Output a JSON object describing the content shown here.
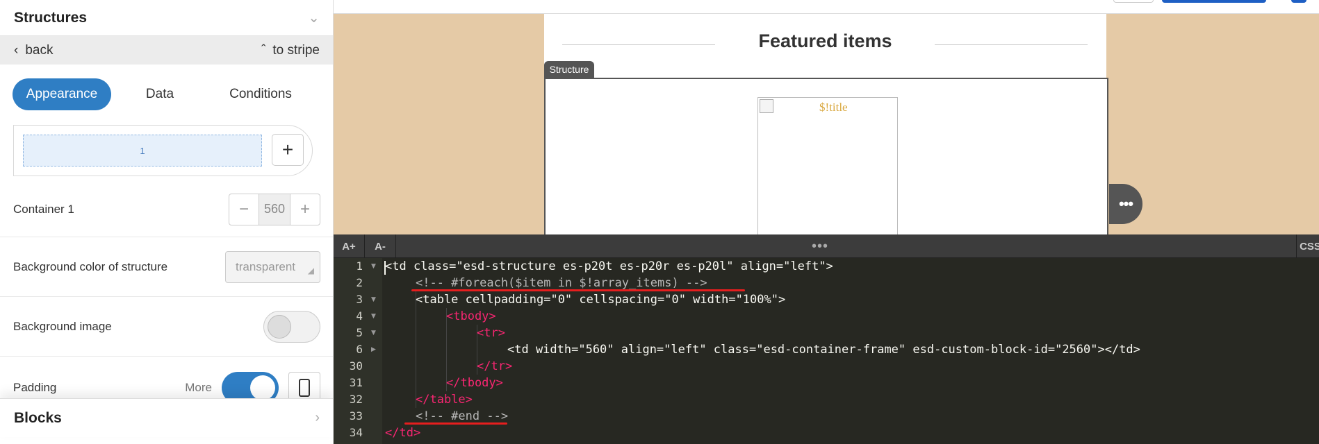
{
  "left_panel": {
    "structures_title": "Structures",
    "back_label": "back",
    "to_stripe_label": "to stripe",
    "tabs": [
      "Appearance",
      "Data",
      "Conditions"
    ],
    "container_slot_label": "1",
    "container_label": "Container 1",
    "container_width": "560",
    "bg_color_label": "Background color of structure",
    "bg_color_value": "transparent",
    "bg_image_label": "Background image",
    "padding_label": "Padding",
    "more_label": "More",
    "blocks_title": "Blocks"
  },
  "preview": {
    "heading": "Featured items",
    "structure_tag": "Structure",
    "image_alt": "$!title"
  },
  "editor": {
    "font_up": "A+",
    "font_down": "A-",
    "tab_css": "CSS",
    "line_numbers": [
      "1",
      "2",
      "3",
      "4",
      "5",
      "6",
      "30",
      "31",
      "32",
      "33",
      "34"
    ],
    "lines": [
      "<td class=\"esd-structure es-p20t es-p20r es-p20l\" align=\"left\">",
      "<!-- #foreach($item in $!array_items) -->",
      "<table cellpadding=\"0\" cellspacing=\"0\" width=\"100%\">",
      "<tbody>",
      "<tr>",
      "<td width=\"560\" align=\"left\" class=\"esd-container-frame\" esd-custom-block-id=\"2560\"></td>",
      "</tr>",
      "</tbody>",
      "</table>",
      "<!-- #end -->",
      "</td>"
    ]
  },
  "colors": {
    "accent": "#2f7ec4",
    "preview_bg": "#e5caa6",
    "editor_bg": "#272822",
    "underline": "#e61e1e"
  }
}
